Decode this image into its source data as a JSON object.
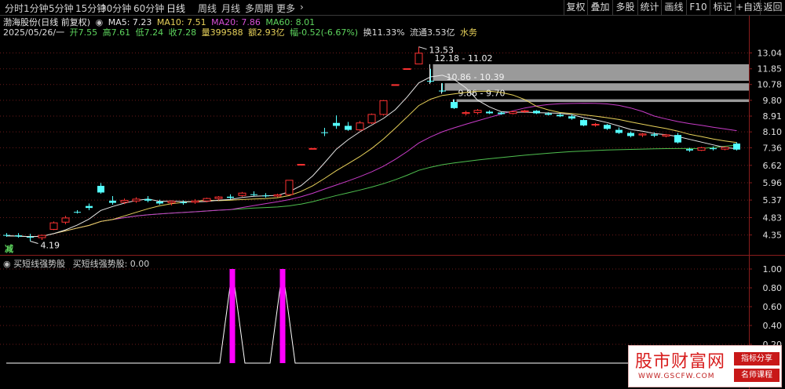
{
  "toolbar": {
    "timeframes": [
      {
        "label": "分时",
        "active": false
      },
      {
        "label": "1分钟",
        "active": false
      },
      {
        "label": "5分钟",
        "active": false
      },
      {
        "label": "15分钟",
        "active": false
      },
      {
        "label": "30分钟",
        "active": false
      },
      {
        "label": "60分钟",
        "active": false
      },
      {
        "label": "日线",
        "active": true
      },
      {
        "label": "周线",
        "active": false
      },
      {
        "label": "月线",
        "active": false
      },
      {
        "label": "多周期",
        "active": false
      },
      {
        "label": "更多",
        "active": false
      }
    ],
    "more_arrow": "›",
    "right_buttons": [
      "复权",
      "叠加",
      "多股",
      "统计",
      "画线",
      "F10",
      "标记",
      "+自选",
      "返回"
    ]
  },
  "info": {
    "stock_title": "渤海股份(日线 前复权)",
    "ma5": "MA5: 7.23",
    "ma10": "MA10: 7.51",
    "ma20": "MA20: 7.86",
    "ma60": "MA60: 8.01",
    "date": "2025/05/26/一",
    "open": "开7.55",
    "high": "高7.61",
    "low": "低7.24",
    "close": "收7.28",
    "volume": "量399588",
    "amount": "额2.93亿",
    "change": "幅-0.52(-6.67%)",
    "turnover": "换11.33%",
    "float": "流通3.53亿",
    "sector": "水务"
  },
  "indicator": {
    "title": "买短线强势股",
    "value_label": "买短线强势股: 0.00",
    "y_ticks": [
      "1.00",
      "0.80",
      "0.60",
      "0.40",
      "0.20"
    ],
    "signals_x": [
      18,
      22
    ],
    "series_length": 54
  },
  "watermark": {
    "main": "股市财富网",
    "url": "WWW.GSCFW.COM",
    "tag1": "指标分享",
    "tag2": "名师课程"
  },
  "colors": {
    "up": "#ff3232",
    "down": "#54ffff",
    "ma5": "#e6e6e6",
    "ma10": "#e8d25a",
    "ma20": "#c83cc8",
    "ma60": "#4fc04f",
    "signal": "#ff00ff",
    "grid": "#6b1a1a"
  },
  "chart_data": {
    "type": "candlestick",
    "title": "渤海股份(日线 前复权)",
    "y_ticks": [
      13.04,
      11.85,
      10.78,
      9.8,
      8.91,
      8.1,
      7.36,
      6.62,
      5.96,
      5.37,
      4.83,
      4.35
    ],
    "ylim": [
      3.95,
      14.3
    ],
    "log_scale": true,
    "annotations": [
      {
        "label": "13.53",
        "type": "high",
        "value": 13.53
      },
      {
        "label": "4.19",
        "type": "low",
        "value": 4.19
      },
      {
        "label": "减",
        "type": "marker"
      }
    ],
    "gap_zones": [
      {
        "label": "12.18 - 11.02",
        "high": 12.18,
        "low": 11.02
      },
      {
        "label": "10.86 - 10.39",
        "high": 10.86,
        "low": 10.39
      },
      {
        "label": "9.86 - 9.70",
        "high": 9.86,
        "low": 9.7
      }
    ],
    "candles": [
      {
        "o": 4.35,
        "h": 4.4,
        "l": 4.3,
        "c": 4.33
      },
      {
        "o": 4.34,
        "h": 4.4,
        "l": 4.28,
        "c": 4.31
      },
      {
        "o": 4.3,
        "h": 4.38,
        "l": 4.19,
        "c": 4.28
      },
      {
        "o": 4.28,
        "h": 4.36,
        "l": 4.22,
        "c": 4.34
      },
      {
        "o": 4.5,
        "h": 4.72,
        "l": 4.48,
        "c": 4.68
      },
      {
        "o": 4.7,
        "h": 4.88,
        "l": 4.64,
        "c": 4.82
      },
      {
        "o": 5.0,
        "h": 5.05,
        "l": 4.95,
        "c": 4.98
      },
      {
        "o": 5.18,
        "h": 5.26,
        "l": 5.05,
        "c": 5.12
      },
      {
        "o": 5.85,
        "h": 5.95,
        "l": 5.58,
        "c": 5.62
      },
      {
        "o": 5.35,
        "h": 5.5,
        "l": 5.22,
        "c": 5.28
      },
      {
        "o": 5.3,
        "h": 5.42,
        "l": 5.24,
        "c": 5.36
      },
      {
        "o": 5.34,
        "h": 5.46,
        "l": 5.28,
        "c": 5.4
      },
      {
        "o": 5.4,
        "h": 5.5,
        "l": 5.3,
        "c": 5.35
      },
      {
        "o": 5.32,
        "h": 5.38,
        "l": 5.22,
        "c": 5.26
      },
      {
        "o": 5.28,
        "h": 5.36,
        "l": 5.2,
        "c": 5.33
      },
      {
        "o": 5.3,
        "h": 5.36,
        "l": 5.22,
        "c": 5.27
      },
      {
        "o": 5.3,
        "h": 5.4,
        "l": 5.25,
        "c": 5.34
      },
      {
        "o": 5.34,
        "h": 5.45,
        "l": 5.3,
        "c": 5.42
      },
      {
        "o": 5.42,
        "h": 5.5,
        "l": 5.36,
        "c": 5.47
      },
      {
        "o": 5.48,
        "h": 5.56,
        "l": 5.4,
        "c": 5.44
      },
      {
        "o": 5.52,
        "h": 5.64,
        "l": 5.48,
        "c": 5.6
      },
      {
        "o": 5.56,
        "h": 5.66,
        "l": 5.5,
        "c": 5.54
      },
      {
        "o": 5.52,
        "h": 5.6,
        "l": 5.45,
        "c": 5.5
      },
      {
        "o": 5.5,
        "h": 5.58,
        "l": 5.46,
        "c": 5.54
      },
      {
        "o": 5.55,
        "h": 6.05,
        "l": 5.54,
        "c": 6.05
      },
      {
        "o": 6.65,
        "h": 6.66,
        "l": 6.65,
        "c": 6.66
      },
      {
        "o": 7.3,
        "h": 7.33,
        "l": 7.29,
        "c": 7.33
      },
      {
        "o": 8.08,
        "h": 8.3,
        "l": 7.9,
        "c": 8.05
      },
      {
        "o": 8.55,
        "h": 8.95,
        "l": 8.25,
        "c": 8.4
      },
      {
        "o": 8.4,
        "h": 8.6,
        "l": 8.15,
        "c": 8.2
      },
      {
        "o": 8.2,
        "h": 8.65,
        "l": 8.15,
        "c": 8.55
      },
      {
        "o": 8.55,
        "h": 9.05,
        "l": 8.5,
        "c": 9.0
      },
      {
        "o": 9.0,
        "h": 9.82,
        "l": 8.95,
        "c": 9.78
      },
      {
        "o": 10.75,
        "h": 10.78,
        "l": 10.75,
        "c": 10.77
      },
      {
        "o": 11.84,
        "h": 11.86,
        "l": 11.84,
        "c": 11.86
      },
      {
        "o": 12.2,
        "h": 13.53,
        "l": 12.18,
        "c": 13.02
      },
      {
        "o": 11.02,
        "h": 11.85,
        "l": 10.9,
        "c": 11.0
      },
      {
        "o": 10.39,
        "h": 10.86,
        "l": 10.3,
        "c": 10.35
      },
      {
        "o": 9.7,
        "h": 9.86,
        "l": 9.3,
        "c": 9.35
      },
      {
        "o": 9.05,
        "h": 9.2,
        "l": 8.95,
        "c": 9.1
      },
      {
        "o": 9.1,
        "h": 9.3,
        "l": 9.0,
        "c": 9.22
      },
      {
        "o": 9.15,
        "h": 9.22,
        "l": 9.02,
        "c": 9.06
      },
      {
        "o": 9.1,
        "h": 9.14,
        "l": 8.98,
        "c": 9.02
      },
      {
        "o": 9.05,
        "h": 9.2,
        "l": 9.0,
        "c": 9.15
      },
      {
        "o": 9.15,
        "h": 9.25,
        "l": 9.08,
        "c": 9.2
      },
      {
        "o": 9.2,
        "h": 9.24,
        "l": 9.02,
        "c": 9.06
      },
      {
        "o": 9.05,
        "h": 9.12,
        "l": 8.94,
        "c": 8.98
      },
      {
        "o": 8.98,
        "h": 9.05,
        "l": 8.86,
        "c": 8.9
      },
      {
        "o": 8.9,
        "h": 9.0,
        "l": 8.72,
        "c": 8.78
      },
      {
        "o": 8.7,
        "h": 8.76,
        "l": 8.38,
        "c": 8.42
      },
      {
        "o": 8.45,
        "h": 8.55,
        "l": 8.36,
        "c": 8.48
      },
      {
        "o": 8.45,
        "h": 8.5,
        "l": 8.2,
        "c": 8.25
      },
      {
        "o": 8.2,
        "h": 8.32,
        "l": 8.0,
        "c": 8.05
      },
      {
        "o": 8.05,
        "h": 8.12,
        "l": 7.84,
        "c": 7.9
      },
      {
        "o": 7.95,
        "h": 8.05,
        "l": 7.85,
        "c": 8.0
      },
      {
        "o": 7.98,
        "h": 8.08,
        "l": 7.85,
        "c": 7.92
      },
      {
        "o": 7.9,
        "h": 8.0,
        "l": 7.84,
        "c": 7.96
      },
      {
        "o": 7.95,
        "h": 8.05,
        "l": 7.55,
        "c": 7.6
      },
      {
        "o": 7.3,
        "h": 7.36,
        "l": 7.18,
        "c": 7.24
      },
      {
        "o": 7.25,
        "h": 7.4,
        "l": 7.22,
        "c": 7.36
      },
      {
        "o": 7.34,
        "h": 7.42,
        "l": 7.24,
        "c": 7.3
      },
      {
        "o": 7.3,
        "h": 7.42,
        "l": 7.25,
        "c": 7.38
      },
      {
        "o": 7.55,
        "h": 7.61,
        "l": 7.24,
        "c": 7.28
      }
    ]
  }
}
